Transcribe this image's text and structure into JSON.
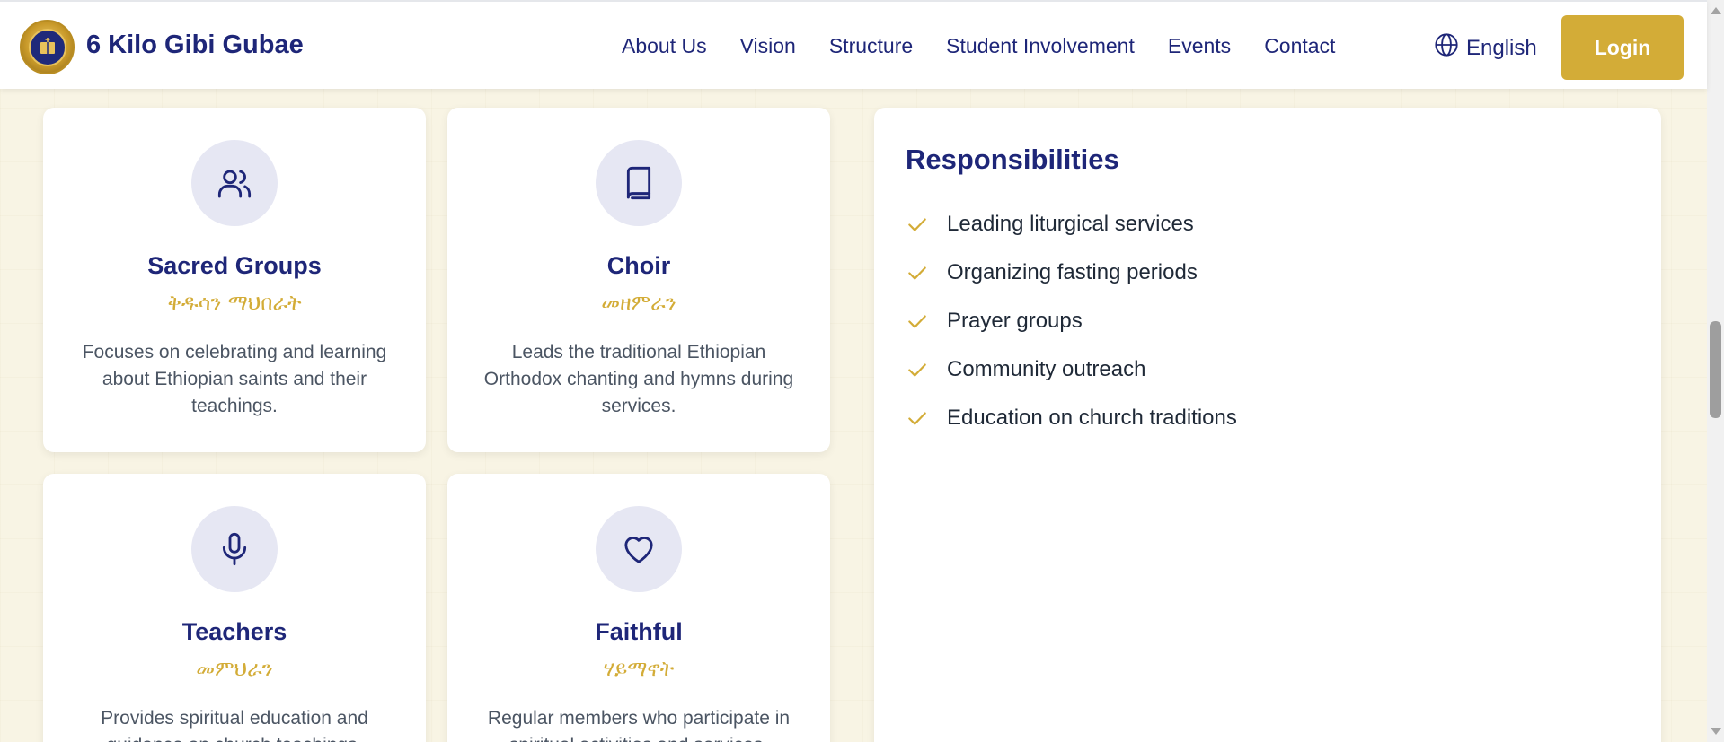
{
  "header": {
    "brand": "6 Kilo Gibi Gubae",
    "nav": [
      "About Us",
      "Vision",
      "Structure",
      "Student Involvement",
      "Events",
      "Contact"
    ],
    "language": "English",
    "login_label": "Login"
  },
  "cards": [
    {
      "icon": "users-icon",
      "title": "Sacred Groups",
      "subtitle": "ቅዱሳን ማህበራት",
      "description": "Focuses on celebrating and learning about Ethiopian saints and their teachings."
    },
    {
      "icon": "book-icon",
      "title": "Choir",
      "subtitle": "መዘምራን",
      "description": "Leads the traditional Ethiopian Orthodox chanting and hymns during services."
    },
    {
      "icon": "microphone-icon",
      "title": "Teachers",
      "subtitle": "መምህራን",
      "description": "Provides spiritual education and guidance on church teachings."
    },
    {
      "icon": "heart-icon",
      "title": "Faithful",
      "subtitle": "ሃይማኖት",
      "description": "Regular members who participate in spiritual activities and services."
    }
  ],
  "responsibilities": {
    "title": "Responsibilities",
    "items": [
      "Leading liturgical services",
      "Organizing fasting periods",
      "Prayer groups",
      "Community outreach",
      "Education on church traditions"
    ]
  },
  "colors": {
    "navy": "#1e2678",
    "gold": "#d3ac37",
    "background": "#f8f4e4"
  }
}
